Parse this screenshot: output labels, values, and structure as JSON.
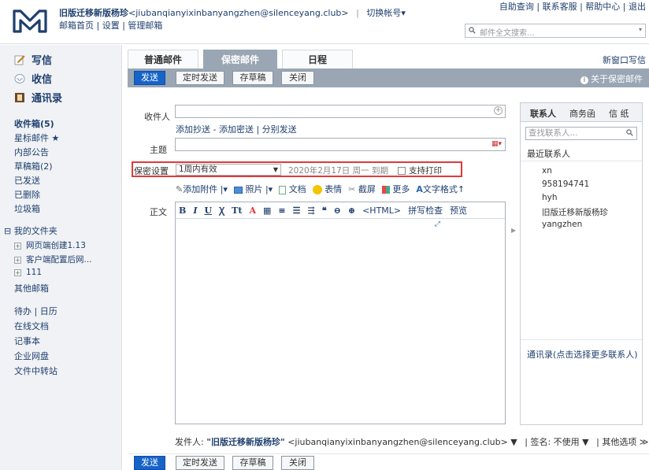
{
  "header": {
    "account_name": "旧版迁移新版杨珍",
    "account_email": "<jiubanqianyixinbanyangzhen@silenceyang.club>",
    "separator": "|",
    "switch_account": "切换帐号▾",
    "sub_links": "邮箱首页 | 设置 | 管理邮箱",
    "top_links": "自助查询 | 联系客服 | 帮助中心 | 退出",
    "search_placeholder": "邮件全文搜索..."
  },
  "sidebar": {
    "compose": "写信",
    "inbox": "收信",
    "contacts": "通讯录",
    "folders": [
      {
        "label": "收件箱(5)",
        "bold": true
      },
      {
        "label": "星标邮件 ★"
      },
      {
        "label": "内部公告"
      },
      {
        "label": "草稿箱(2)"
      },
      {
        "label": "已发送"
      },
      {
        "label": "已删除"
      },
      {
        "label": "垃圾箱"
      }
    ],
    "my_folders": "⊟ 我的文件夹",
    "my_folder_items": [
      "网页端创建1.13",
      "客户端配置后网...",
      "111"
    ],
    "other_mailbox": "其他邮箱",
    "tools": [
      "待办 | 日历",
      "在线文档",
      "记事本",
      "企业网盘",
      "文件中转站"
    ]
  },
  "tabs": [
    {
      "label": "普通邮件",
      "active": false
    },
    {
      "label": "保密邮件",
      "active": true
    },
    {
      "label": "日程",
      "active": false
    }
  ],
  "new_window": "新窗口写信",
  "toolbar": {
    "send": "发送",
    "scheduled_send": "定时发送",
    "save_draft": "存草稿",
    "close": "关闭",
    "about": "关于保密邮件"
  },
  "form": {
    "to_label": "收件人",
    "cc_links": "添加抄送 - 添加密送 | 分别发送",
    "subject_label": "主题",
    "security_label": "保密设置",
    "security_value": "1周内有效",
    "expiry": "2020年2月17日 周一 到期",
    "print_label": "支持打印",
    "attach_items": [
      "添加附件 |▾",
      "照片 |▾",
      "文档",
      "表情",
      "截屏",
      "更多",
      "文字格式↑"
    ],
    "body_label": "正文",
    "format_items": [
      "B",
      "I",
      "U",
      "Ꭓ",
      "Tt",
      "A",
      "▦",
      "≡",
      "☰",
      "⇶",
      "❝",
      "⊖",
      "⊕",
      "<HTML>",
      "拼写检查",
      "预览"
    ]
  },
  "contacts_panel": {
    "tabs": [
      "联系人",
      "商务函",
      "信 纸"
    ],
    "search_placeholder": "查找联系人...",
    "recent_label": "最近联系人",
    "recent": [
      "xn",
      "958194741",
      "hyh",
      "旧版迁移新版杨珍",
      "yangzhen"
    ],
    "footer_link": "通讯录",
    "footer_note": "(点击选择更多联系人)"
  },
  "sender": {
    "label": "发件人:",
    "name": "\"旧版迁移新版杨珍\"",
    "email": "<jiubanqianyixinbanyangzhen@silenceyang.club> ▼",
    "signature": "| 签名: 不使用 ▼",
    "other_options": "| 其他选项 ≫"
  },
  "colors": {
    "toolbar_bg": "#9aa6b4",
    "primary_button": "#1764c8",
    "highlight_border": "#e03a3a",
    "link": "#1f3f6e"
  }
}
